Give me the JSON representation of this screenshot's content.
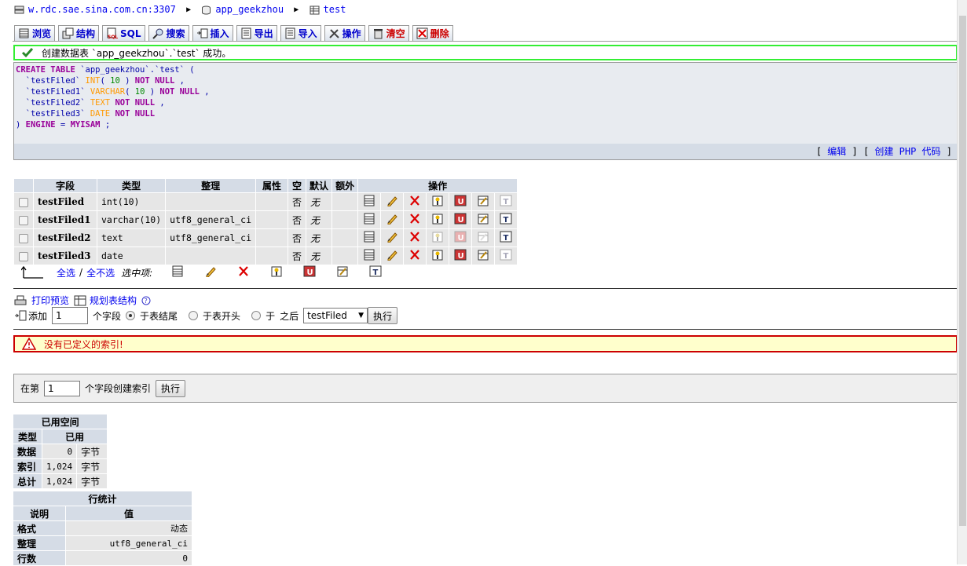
{
  "breadcrumb": {
    "server": "w.rdc.sae.sina.com.cn:3307",
    "database": "app_geekzhou",
    "table": "test"
  },
  "tabs": [
    {
      "label": "浏览",
      "icon": "browse-icon"
    },
    {
      "label": "结构",
      "icon": "structure-icon"
    },
    {
      "label": "SQL",
      "icon": "sql-icon"
    },
    {
      "label": "搜索",
      "icon": "search-icon"
    },
    {
      "label": "插入",
      "icon": "insert-icon"
    },
    {
      "label": "导出",
      "icon": "export-icon"
    },
    {
      "label": "导入",
      "icon": "import-icon"
    },
    {
      "label": "操作",
      "icon": "operations-icon"
    },
    {
      "label": "清空",
      "icon": "empty-icon"
    },
    {
      "label": "删除",
      "icon": "drop-icon"
    }
  ],
  "success_message": "创建数据表 `app_geekzhou`.`test` 成功。",
  "sql_links": {
    "edit": "编辑",
    "create_php": "创建 PHP 代码"
  },
  "fields_table": {
    "headers": {
      "field": "字段",
      "type": "类型",
      "collation": "整理",
      "attributes": "属性",
      "null": "空",
      "default": "默认",
      "extra": "额外",
      "action": "操作"
    },
    "rows": [
      {
        "name": "testFiled",
        "type": "int(10)",
        "collation": "",
        "attributes": "",
        "null": "否",
        "default": "无",
        "extra": "",
        "disabled_idx": false
      },
      {
        "name": "testFiled1",
        "type": "varchar(10)",
        "collation": "utf8_general_ci",
        "attributes": "",
        "null": "否",
        "default": "无",
        "extra": "",
        "disabled_idx": false
      },
      {
        "name": "testFiled2",
        "type": "text",
        "collation": "utf8_general_ci",
        "attributes": "",
        "null": "否",
        "default": "无",
        "extra": "",
        "disabled_idx": true
      },
      {
        "name": "testFiled3",
        "type": "date",
        "collation": "",
        "attributes": "",
        "null": "否",
        "default": "无",
        "extra": "",
        "disabled_idx": false
      }
    ]
  },
  "selection": {
    "check_all": "全选",
    "separator": "/",
    "uncheck_all": "全不选",
    "with_selected": "选中项:"
  },
  "print_view": "打印预览",
  "propose_structure": "规划表结构",
  "add_fields": {
    "label": "添加",
    "count": "1",
    "fields_label": "个字段",
    "opt_end": "于表结尾",
    "opt_begin": "于表开头",
    "opt_after_pre": "于",
    "opt_after_post": "之后",
    "after_field": "testFiled",
    "go": "执行"
  },
  "no_index": "没有已定义的索引!",
  "create_index": {
    "prefix": "在第",
    "count": "1",
    "suffix": "个字段创建索引",
    "go": "执行"
  },
  "space_usage": {
    "title": "已用空间",
    "headers": [
      "类型",
      "已用"
    ],
    "rows": [
      {
        "label": "数据",
        "value": "0",
        "unit": "字节"
      },
      {
        "label": "索引",
        "value": "1,024",
        "unit": "字节"
      },
      {
        "label": "总计",
        "value": "1,024",
        "unit": "字节"
      }
    ]
  },
  "row_stats": {
    "title": "行统计",
    "headers": [
      "说明",
      "值"
    ],
    "rows": [
      {
        "label": "格式",
        "value": "动态"
      },
      {
        "label": "整理",
        "value": "utf8_general_ci"
      },
      {
        "label": "行数",
        "value": "0"
      }
    ]
  }
}
